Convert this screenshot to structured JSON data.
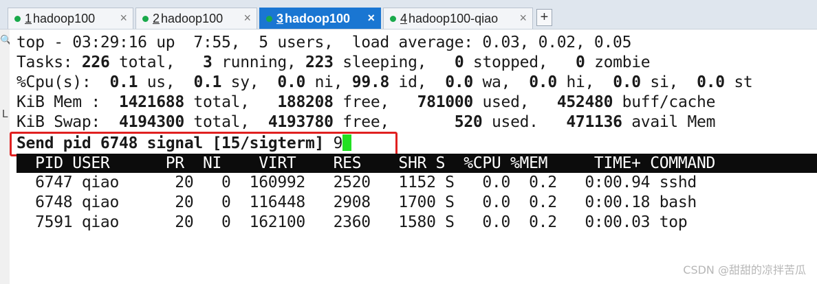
{
  "tabs": [
    {
      "num": "1",
      "title": " hadoop100",
      "active": false
    },
    {
      "num": "2",
      "title": " hadoop100",
      "active": false
    },
    {
      "num": "3",
      "title": " hadoop100",
      "active": true
    },
    {
      "num": "4",
      "title": " hadoop100-qiao",
      "active": false
    }
  ],
  "new_tab_label": "+",
  "close_glyph": "×",
  "status_color": "#19a94b",
  "gutter": {
    "search": "🔍",
    "mark": "L"
  },
  "top": {
    "line1": "top - 03:29:16 up  7:55,  5 users,  load average: 0.03, 0.02, 0.05",
    "tasks": {
      "label": "Tasks: ",
      "total": "226",
      "t1": " total,   ",
      "running": "3",
      "t2": " running, ",
      "sleeping": "223",
      "t3": " sleeping,   ",
      "stopped": "0",
      "t4": " stopped,   ",
      "zombie": "0",
      "t5": " zombie"
    },
    "cpu": {
      "label": "%Cpu(s):  ",
      "us": "0.1",
      "t1": " us,  ",
      "sy": "0.1",
      "t2": " sy,  ",
      "ni": "0.0",
      "t3": " ni, ",
      "id": "99.8",
      "t4": " id,  ",
      "wa": "0.0",
      "t5": " wa,  ",
      "hi": "0.0",
      "t6": " hi,  ",
      "si": "0.0",
      "t7": " si,  ",
      "st": "0.0",
      "t8": " st"
    },
    "mem": {
      "label": "KiB Mem :  ",
      "total": "1421688",
      "t1": " total,   ",
      "free": "188208",
      "t2": " free,   ",
      "used": "781000",
      "t3": " used,   ",
      "buff": "452480",
      "t4": " buff/cache"
    },
    "swap": {
      "label": "KiB Swap:  ",
      "total": "4194300",
      "t1": " total,  ",
      "free": "4193780",
      "t2": " free,       ",
      "used": "520",
      "t3": " used.   ",
      "avail": "471136",
      "t4": " avail Mem"
    },
    "prompt": "Send pid 6748 signal [15/sigterm] ",
    "prompt_input": "9",
    "header": "  PID USER      PR  NI    VIRT    RES    SHR S  %CPU %MEM     TIME+ COMMAND",
    "processes": [
      "  6747 qiao      20   0  160992   2520   1152 S   0.0  0.2   0:00.94 sshd",
      "  6748 qiao      20   0  116448   2908   1700 S   0.0  0.2   0:00.18 bash",
      "  7591 qiao      20   0  162100   2360   1580 S   0.0  0.2   0:00.03 top"
    ]
  },
  "watermark": "CSDN @甜甜的凉拌苦瓜"
}
